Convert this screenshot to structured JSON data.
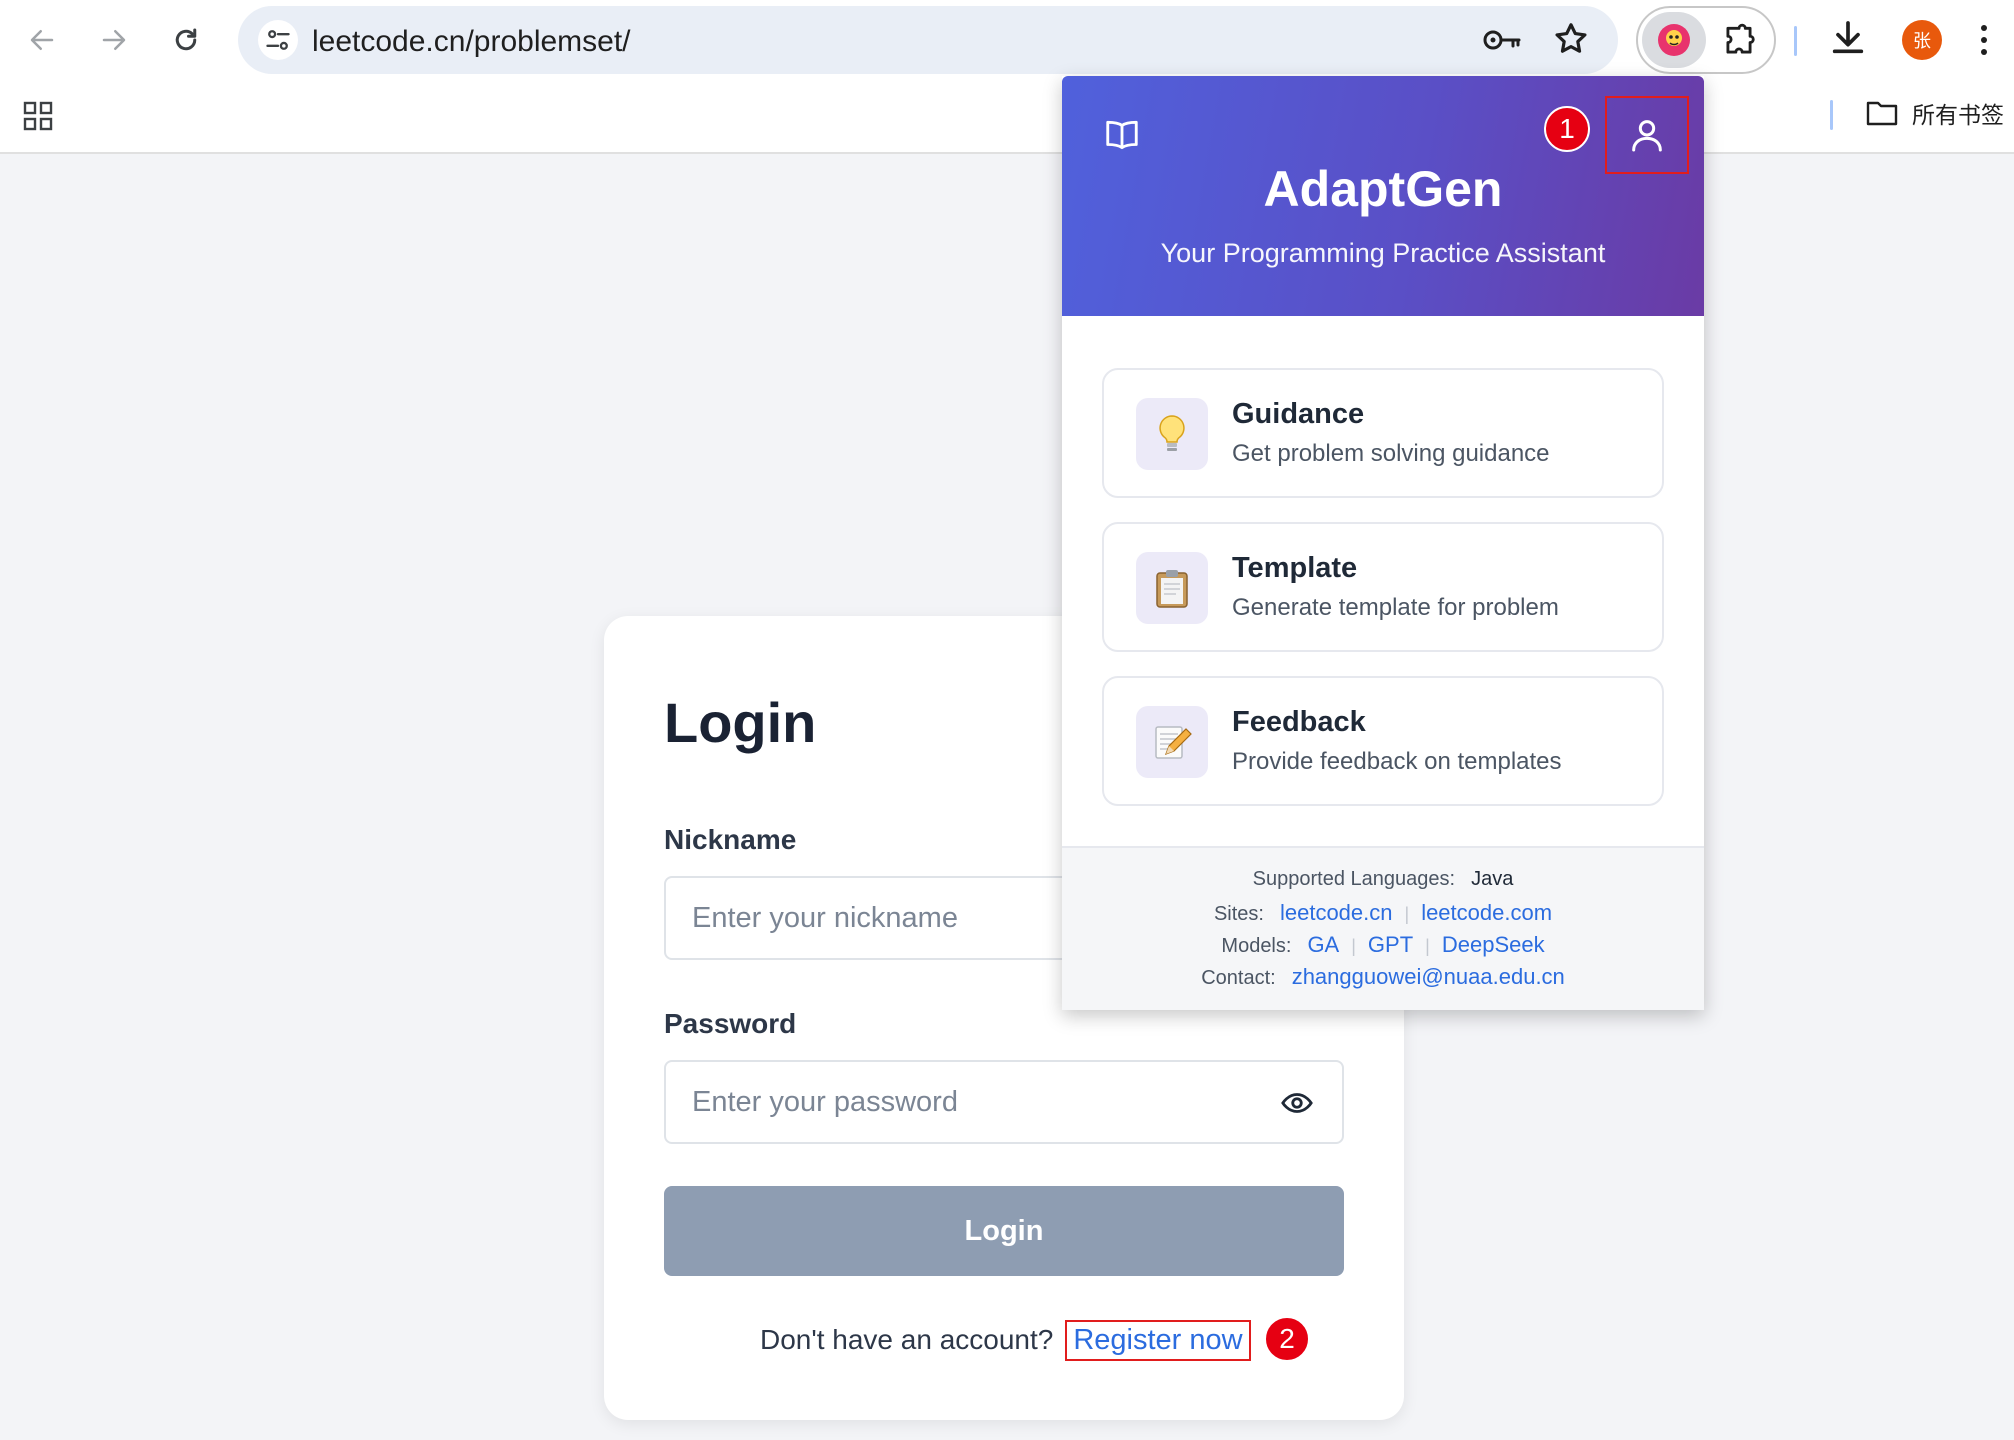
{
  "browser": {
    "url": "leetcode.cn/problemset/",
    "profile_initial": "张",
    "bookmarks_folder": "所有书签"
  },
  "login": {
    "title": "Login",
    "nickname_label": "Nickname",
    "nickname_placeholder": "Enter your nickname",
    "password_label": "Password",
    "password_placeholder": "Enter your password",
    "login_button": "Login",
    "no_account_text": "Don't have an account?",
    "register_link": "Register now"
  },
  "annotations": {
    "step1": "1",
    "step2": "2"
  },
  "popup": {
    "app_name": "AdaptGen",
    "tagline": "Your Programming Practice Assistant",
    "features": [
      {
        "title": "Guidance",
        "description": "Get problem solving guidance",
        "icon": "lightbulb-icon"
      },
      {
        "title": "Template",
        "description": "Generate template for problem",
        "icon": "clipboard-icon"
      },
      {
        "title": "Feedback",
        "description": "Provide feedback on templates",
        "icon": "memo-icon"
      }
    ],
    "footer": {
      "languages_label": "Supported Languages:",
      "languages_value": "Java",
      "sites_label": "Sites:",
      "sites": [
        "leetcode.cn",
        "leetcode.com"
      ],
      "models_label": "Models:",
      "models": [
        "GA",
        "GPT",
        "DeepSeek"
      ],
      "contact_label": "Contact:",
      "contact_email": "zhangguowei@nuaa.edu.cn"
    }
  },
  "colors": {
    "header_gradient_start": "#5061dc",
    "header_gradient_end": "#6a3ba5",
    "link": "#2b6cdf",
    "annotation_red": "#e60012",
    "login_button_disabled": "#8e9db2"
  }
}
